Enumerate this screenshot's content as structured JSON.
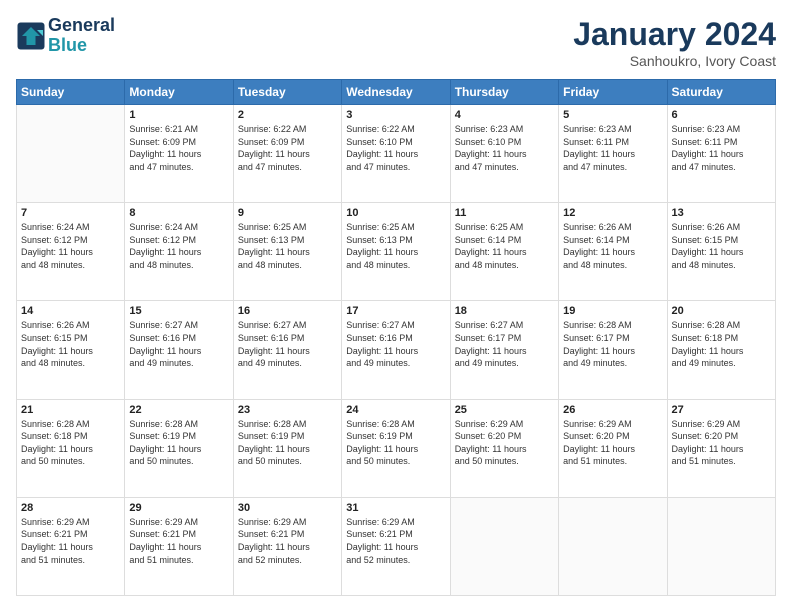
{
  "logo": {
    "line1": "General",
    "line2": "Blue"
  },
  "title": "January 2024",
  "subtitle": "Sanhoukro, Ivory Coast",
  "header_days": [
    "Sunday",
    "Monday",
    "Tuesday",
    "Wednesday",
    "Thursday",
    "Friday",
    "Saturday"
  ],
  "weeks": [
    [
      {
        "day": "",
        "info": ""
      },
      {
        "day": "1",
        "info": "Sunrise: 6:21 AM\nSunset: 6:09 PM\nDaylight: 11 hours\nand 47 minutes."
      },
      {
        "day": "2",
        "info": "Sunrise: 6:22 AM\nSunset: 6:09 PM\nDaylight: 11 hours\nand 47 minutes."
      },
      {
        "day": "3",
        "info": "Sunrise: 6:22 AM\nSunset: 6:10 PM\nDaylight: 11 hours\nand 47 minutes."
      },
      {
        "day": "4",
        "info": "Sunrise: 6:23 AM\nSunset: 6:10 PM\nDaylight: 11 hours\nand 47 minutes."
      },
      {
        "day": "5",
        "info": "Sunrise: 6:23 AM\nSunset: 6:11 PM\nDaylight: 11 hours\nand 47 minutes."
      },
      {
        "day": "6",
        "info": "Sunrise: 6:23 AM\nSunset: 6:11 PM\nDaylight: 11 hours\nand 47 minutes."
      }
    ],
    [
      {
        "day": "7",
        "info": "Sunrise: 6:24 AM\nSunset: 6:12 PM\nDaylight: 11 hours\nand 48 minutes."
      },
      {
        "day": "8",
        "info": "Sunrise: 6:24 AM\nSunset: 6:12 PM\nDaylight: 11 hours\nand 48 minutes."
      },
      {
        "day": "9",
        "info": "Sunrise: 6:25 AM\nSunset: 6:13 PM\nDaylight: 11 hours\nand 48 minutes."
      },
      {
        "day": "10",
        "info": "Sunrise: 6:25 AM\nSunset: 6:13 PM\nDaylight: 11 hours\nand 48 minutes."
      },
      {
        "day": "11",
        "info": "Sunrise: 6:25 AM\nSunset: 6:14 PM\nDaylight: 11 hours\nand 48 minutes."
      },
      {
        "day": "12",
        "info": "Sunrise: 6:26 AM\nSunset: 6:14 PM\nDaylight: 11 hours\nand 48 minutes."
      },
      {
        "day": "13",
        "info": "Sunrise: 6:26 AM\nSunset: 6:15 PM\nDaylight: 11 hours\nand 48 minutes."
      }
    ],
    [
      {
        "day": "14",
        "info": "Sunrise: 6:26 AM\nSunset: 6:15 PM\nDaylight: 11 hours\nand 48 minutes."
      },
      {
        "day": "15",
        "info": "Sunrise: 6:27 AM\nSunset: 6:16 PM\nDaylight: 11 hours\nand 49 minutes."
      },
      {
        "day": "16",
        "info": "Sunrise: 6:27 AM\nSunset: 6:16 PM\nDaylight: 11 hours\nand 49 minutes."
      },
      {
        "day": "17",
        "info": "Sunrise: 6:27 AM\nSunset: 6:16 PM\nDaylight: 11 hours\nand 49 minutes."
      },
      {
        "day": "18",
        "info": "Sunrise: 6:27 AM\nSunset: 6:17 PM\nDaylight: 11 hours\nand 49 minutes."
      },
      {
        "day": "19",
        "info": "Sunrise: 6:28 AM\nSunset: 6:17 PM\nDaylight: 11 hours\nand 49 minutes."
      },
      {
        "day": "20",
        "info": "Sunrise: 6:28 AM\nSunset: 6:18 PM\nDaylight: 11 hours\nand 49 minutes."
      }
    ],
    [
      {
        "day": "21",
        "info": "Sunrise: 6:28 AM\nSunset: 6:18 PM\nDaylight: 11 hours\nand 50 minutes."
      },
      {
        "day": "22",
        "info": "Sunrise: 6:28 AM\nSunset: 6:19 PM\nDaylight: 11 hours\nand 50 minutes."
      },
      {
        "day": "23",
        "info": "Sunrise: 6:28 AM\nSunset: 6:19 PM\nDaylight: 11 hours\nand 50 minutes."
      },
      {
        "day": "24",
        "info": "Sunrise: 6:28 AM\nSunset: 6:19 PM\nDaylight: 11 hours\nand 50 minutes."
      },
      {
        "day": "25",
        "info": "Sunrise: 6:29 AM\nSunset: 6:20 PM\nDaylight: 11 hours\nand 50 minutes."
      },
      {
        "day": "26",
        "info": "Sunrise: 6:29 AM\nSunset: 6:20 PM\nDaylight: 11 hours\nand 51 minutes."
      },
      {
        "day": "27",
        "info": "Sunrise: 6:29 AM\nSunset: 6:20 PM\nDaylight: 11 hours\nand 51 minutes."
      }
    ],
    [
      {
        "day": "28",
        "info": "Sunrise: 6:29 AM\nSunset: 6:21 PM\nDaylight: 11 hours\nand 51 minutes."
      },
      {
        "day": "29",
        "info": "Sunrise: 6:29 AM\nSunset: 6:21 PM\nDaylight: 11 hours\nand 51 minutes."
      },
      {
        "day": "30",
        "info": "Sunrise: 6:29 AM\nSunset: 6:21 PM\nDaylight: 11 hours\nand 52 minutes."
      },
      {
        "day": "31",
        "info": "Sunrise: 6:29 AM\nSunset: 6:21 PM\nDaylight: 11 hours\nand 52 minutes."
      },
      {
        "day": "",
        "info": ""
      },
      {
        "day": "",
        "info": ""
      },
      {
        "day": "",
        "info": ""
      }
    ]
  ]
}
